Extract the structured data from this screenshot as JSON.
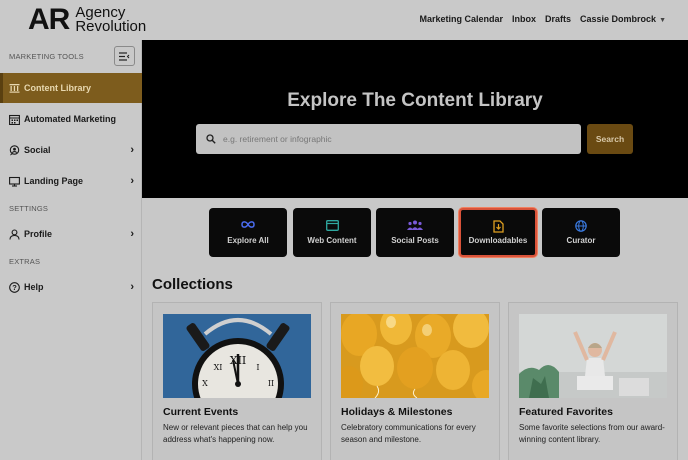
{
  "brand": {
    "mark": "AR",
    "name_line1": "Agency",
    "name_line2": "Revolution"
  },
  "top_nav": {
    "marketing_calendar": "Marketing Calendar",
    "inbox": "Inbox",
    "drafts": "Drafts",
    "user": "Cassie Dombrock"
  },
  "sidebar": {
    "section_tools": "MARKETING TOOLS",
    "section_settings": "SETTINGS",
    "section_extras": "EXTRAS",
    "items": [
      {
        "label": "Content Library",
        "icon": "library-icon",
        "active": true
      },
      {
        "label": "Automated Marketing",
        "icon": "calendar-icon"
      },
      {
        "label": "Social",
        "icon": "social-icon"
      },
      {
        "label": "Landing Page",
        "icon": "monitor-icon"
      },
      {
        "label": "Profile",
        "icon": "user-icon"
      },
      {
        "label": "Help",
        "icon": "help-icon"
      }
    ]
  },
  "hero": {
    "title": "Explore The Content Library",
    "search_placeholder": "e.g. retirement or infographic",
    "search_button": "Search"
  },
  "categories": [
    {
      "label": "Explore All",
      "icon": "infinity-icon",
      "color": "#4a6cf0"
    },
    {
      "label": "Web Content",
      "icon": "browser-icon",
      "color": "#2fa8a0"
    },
    {
      "label": "Social Posts",
      "icon": "people-icon",
      "color": "#7a5ad8"
    },
    {
      "label": "Downloadables",
      "icon": "download-doc-icon",
      "color": "#e0a020",
      "selected": true
    },
    {
      "label": "Curator",
      "icon": "globe-icon",
      "color": "#3a7ae0"
    }
  ],
  "collections": {
    "title": "Collections",
    "cards": [
      {
        "title": "Current Events",
        "description": "New or relevant pieces that can help you address what's happening now."
      },
      {
        "title": "Holidays & Milestones",
        "description": "Celebratory communications for every season and milestone."
      },
      {
        "title": "Featured Favorites",
        "description": "Some favorite selections from our award-winning content library."
      }
    ]
  },
  "colors": {
    "accent": "#7d5c1d",
    "selected_border": "#d9533a"
  }
}
